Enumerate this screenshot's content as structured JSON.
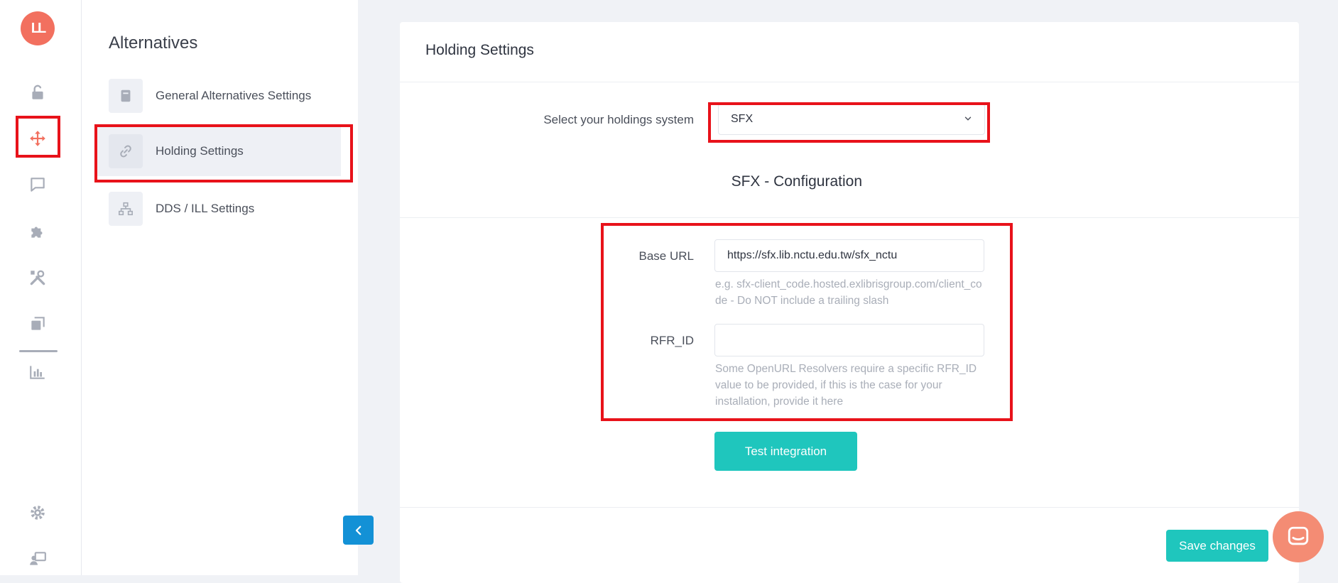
{
  "logo": {
    "text": "LL",
    "color": "#f2705f"
  },
  "rail": {
    "icons": [
      "unlock-icon",
      "move-arrows-icon",
      "chat-icon",
      "puzzle-icon",
      "tools-icon",
      "copy-icon",
      "bar-chart-icon",
      "gear-icon",
      "user-screen-icon"
    ],
    "active": "move-arrows-icon",
    "active_color": "#f2705f"
  },
  "sidebar": {
    "title": "Alternatives",
    "items": [
      {
        "label": "General Alternatives Settings",
        "icon": "book-icon"
      },
      {
        "label": "Holding Settings",
        "icon": "link-icon"
      },
      {
        "label": "DDS / ILL Settings",
        "icon": "sitemap-icon"
      }
    ]
  },
  "main": {
    "title": "Holding Settings",
    "holdings_label": "Select your holdings system",
    "holdings_value": "SFX",
    "section_title": "SFX - Configuration",
    "base_url": {
      "label": "Base URL",
      "value": "https://sfx.lib.nctu.edu.tw/sfx_nctu",
      "help": "e.g. sfx-client_code.hosted.exlibrisgroup.com/client_code - Do NOT include a trailing slash"
    },
    "rfr_id": {
      "label": "RFR_ID",
      "value": "",
      "help": "Some OpenURL Resolvers require a specific RFR_ID value to be provided, if this is the case for your installation, provide it here"
    },
    "test_button": "Test integration",
    "save_button": "Save changes"
  },
  "colors": {
    "accent": "#1fc6bd",
    "highlight": "#e8121a",
    "collapse": "#1391d6"
  }
}
